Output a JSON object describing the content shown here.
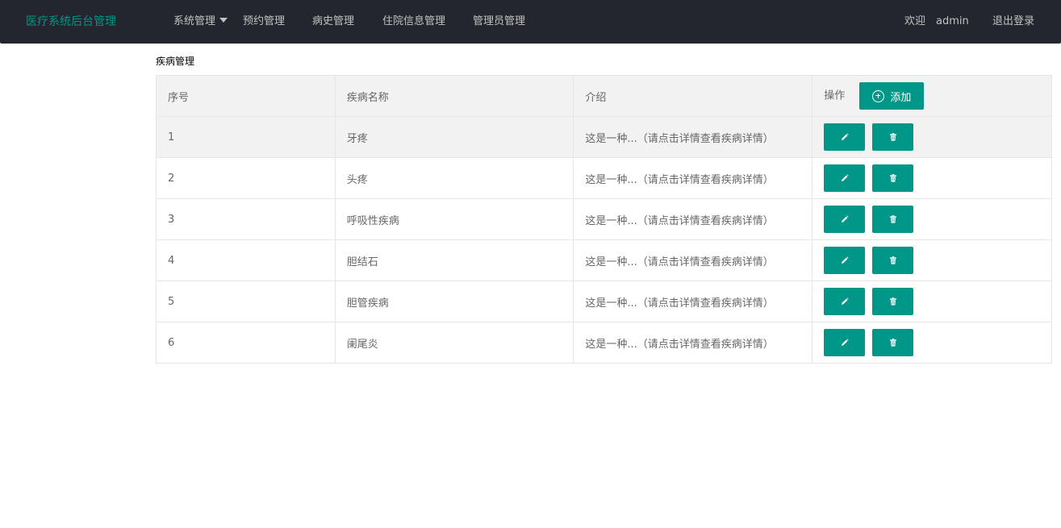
{
  "header": {
    "logo": "医疗系统后台管理",
    "nav": [
      {
        "label": "系统管理",
        "has_dropdown": true
      },
      {
        "label": "预约管理"
      },
      {
        "label": "病史管理"
      },
      {
        "label": "住院信息管理"
      },
      {
        "label": "管理员管理"
      }
    ],
    "welcome": "欢迎",
    "username": "admin",
    "logout": "退出登录"
  },
  "page": {
    "title": "疾病管理"
  },
  "table": {
    "headers": {
      "index": "序号",
      "name": "疾病名称",
      "description": "介绍",
      "operation": "操作"
    },
    "add_button": "添加",
    "rows": [
      {
        "index": "1",
        "name": "牙疼",
        "description": "这是一种...（请点击详情查看疾病详情）"
      },
      {
        "index": "2",
        "name": "头疼",
        "description": "这是一种...（请点击详情查看疾病详情）"
      },
      {
        "index": "3",
        "name": "呼吸性疾病",
        "description": "这是一种...（请点击详情查看疾病详情）"
      },
      {
        "index": "4",
        "name": "胆结石",
        "description": "这是一种...（请点击详情查看疾病详情）"
      },
      {
        "index": "5",
        "name": "胆管疾病",
        "description": "这是一种...（请点击详情查看疾病详情）"
      },
      {
        "index": "6",
        "name": "阑尾炎",
        "description": "这是一种...（请点击详情查看疾病详情）"
      }
    ]
  },
  "icons": {
    "edit": "pencil-icon",
    "delete": "trash-icon",
    "add": "plus-circle-icon",
    "dropdown": "caret-down-icon"
  },
  "colors": {
    "header_bg": "#23262e",
    "accent": "#009688",
    "nav_text": "#c2c2c2",
    "table_header_bg": "#f2f2f2",
    "border": "#e6e6e6"
  }
}
